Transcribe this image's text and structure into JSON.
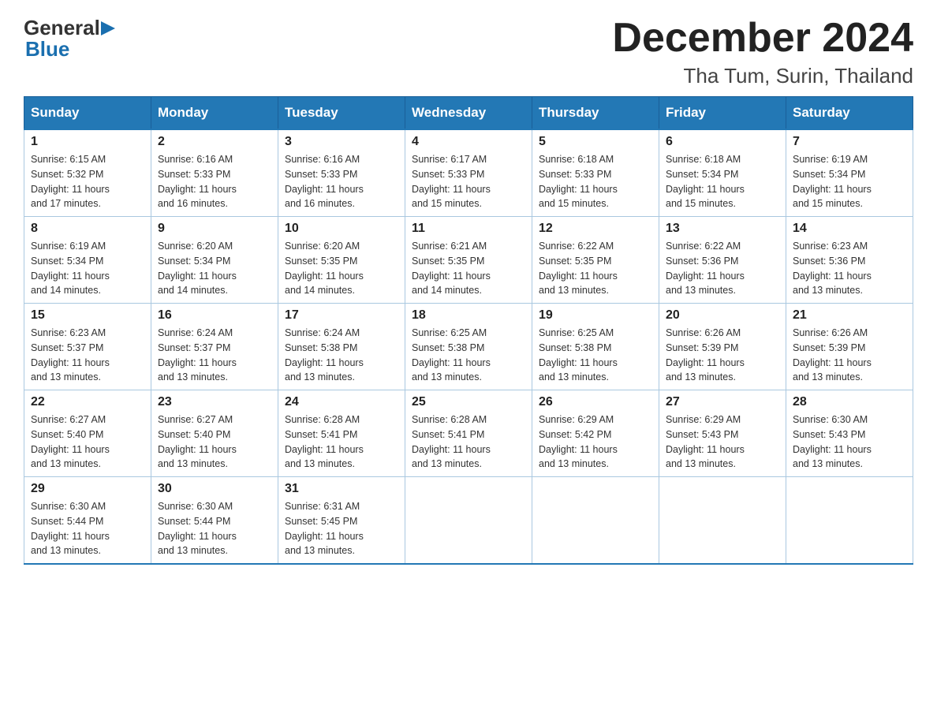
{
  "header": {
    "month_year": "December 2024",
    "location": "Tha Tum, Surin, Thailand",
    "logo_general": "General",
    "logo_blue": "Blue"
  },
  "days_of_week": [
    "Sunday",
    "Monday",
    "Tuesday",
    "Wednesday",
    "Thursday",
    "Friday",
    "Saturday"
  ],
  "weeks": [
    [
      {
        "day": "1",
        "sunrise": "6:15 AM",
        "sunset": "5:32 PM",
        "daylight": "11 hours and 17 minutes."
      },
      {
        "day": "2",
        "sunrise": "6:16 AM",
        "sunset": "5:33 PM",
        "daylight": "11 hours and 16 minutes."
      },
      {
        "day": "3",
        "sunrise": "6:16 AM",
        "sunset": "5:33 PM",
        "daylight": "11 hours and 16 minutes."
      },
      {
        "day": "4",
        "sunrise": "6:17 AM",
        "sunset": "5:33 PM",
        "daylight": "11 hours and 15 minutes."
      },
      {
        "day": "5",
        "sunrise": "6:18 AM",
        "sunset": "5:33 PM",
        "daylight": "11 hours and 15 minutes."
      },
      {
        "day": "6",
        "sunrise": "6:18 AM",
        "sunset": "5:34 PM",
        "daylight": "11 hours and 15 minutes."
      },
      {
        "day": "7",
        "sunrise": "6:19 AM",
        "sunset": "5:34 PM",
        "daylight": "11 hours and 15 minutes."
      }
    ],
    [
      {
        "day": "8",
        "sunrise": "6:19 AM",
        "sunset": "5:34 PM",
        "daylight": "11 hours and 14 minutes."
      },
      {
        "day": "9",
        "sunrise": "6:20 AM",
        "sunset": "5:34 PM",
        "daylight": "11 hours and 14 minutes."
      },
      {
        "day": "10",
        "sunrise": "6:20 AM",
        "sunset": "5:35 PM",
        "daylight": "11 hours and 14 minutes."
      },
      {
        "day": "11",
        "sunrise": "6:21 AM",
        "sunset": "5:35 PM",
        "daylight": "11 hours and 14 minutes."
      },
      {
        "day": "12",
        "sunrise": "6:22 AM",
        "sunset": "5:35 PM",
        "daylight": "11 hours and 13 minutes."
      },
      {
        "day": "13",
        "sunrise": "6:22 AM",
        "sunset": "5:36 PM",
        "daylight": "11 hours and 13 minutes."
      },
      {
        "day": "14",
        "sunrise": "6:23 AM",
        "sunset": "5:36 PM",
        "daylight": "11 hours and 13 minutes."
      }
    ],
    [
      {
        "day": "15",
        "sunrise": "6:23 AM",
        "sunset": "5:37 PM",
        "daylight": "11 hours and 13 minutes."
      },
      {
        "day": "16",
        "sunrise": "6:24 AM",
        "sunset": "5:37 PM",
        "daylight": "11 hours and 13 minutes."
      },
      {
        "day": "17",
        "sunrise": "6:24 AM",
        "sunset": "5:38 PM",
        "daylight": "11 hours and 13 minutes."
      },
      {
        "day": "18",
        "sunrise": "6:25 AM",
        "sunset": "5:38 PM",
        "daylight": "11 hours and 13 minutes."
      },
      {
        "day": "19",
        "sunrise": "6:25 AM",
        "sunset": "5:38 PM",
        "daylight": "11 hours and 13 minutes."
      },
      {
        "day": "20",
        "sunrise": "6:26 AM",
        "sunset": "5:39 PM",
        "daylight": "11 hours and 13 minutes."
      },
      {
        "day": "21",
        "sunrise": "6:26 AM",
        "sunset": "5:39 PM",
        "daylight": "11 hours and 13 minutes."
      }
    ],
    [
      {
        "day": "22",
        "sunrise": "6:27 AM",
        "sunset": "5:40 PM",
        "daylight": "11 hours and 13 minutes."
      },
      {
        "day": "23",
        "sunrise": "6:27 AM",
        "sunset": "5:40 PM",
        "daylight": "11 hours and 13 minutes."
      },
      {
        "day": "24",
        "sunrise": "6:28 AM",
        "sunset": "5:41 PM",
        "daylight": "11 hours and 13 minutes."
      },
      {
        "day": "25",
        "sunrise": "6:28 AM",
        "sunset": "5:41 PM",
        "daylight": "11 hours and 13 minutes."
      },
      {
        "day": "26",
        "sunrise": "6:29 AM",
        "sunset": "5:42 PM",
        "daylight": "11 hours and 13 minutes."
      },
      {
        "day": "27",
        "sunrise": "6:29 AM",
        "sunset": "5:43 PM",
        "daylight": "11 hours and 13 minutes."
      },
      {
        "day": "28",
        "sunrise": "6:30 AM",
        "sunset": "5:43 PM",
        "daylight": "11 hours and 13 minutes."
      }
    ],
    [
      {
        "day": "29",
        "sunrise": "6:30 AM",
        "sunset": "5:44 PM",
        "daylight": "11 hours and 13 minutes."
      },
      {
        "day": "30",
        "sunrise": "6:30 AM",
        "sunset": "5:44 PM",
        "daylight": "11 hours and 13 minutes."
      },
      {
        "day": "31",
        "sunrise": "6:31 AM",
        "sunset": "5:45 PM",
        "daylight": "11 hours and 13 minutes."
      },
      null,
      null,
      null,
      null
    ]
  ],
  "labels": {
    "sunrise": "Sunrise:",
    "sunset": "Sunset:",
    "daylight": "Daylight:"
  }
}
